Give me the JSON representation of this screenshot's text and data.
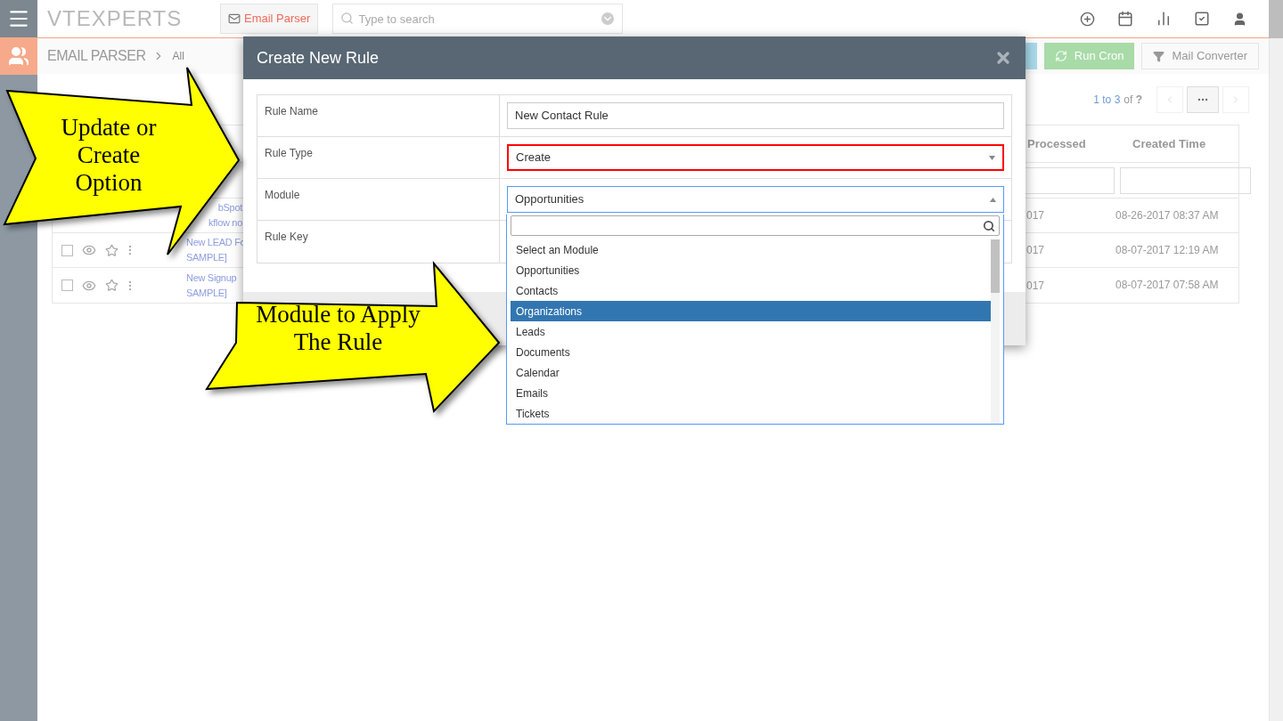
{
  "topbar": {
    "logo": "VTEXPERTS",
    "module_button": "Email Parser",
    "search": {
      "placeholder": "Type to search"
    }
  },
  "breadcrumb": {
    "module": "EMAIL PARSER",
    "view": "All"
  },
  "actions": [
    {
      "kind": "hidden"
    },
    {
      "kind": "cron",
      "label": "Run Cron"
    },
    {
      "kind": "converter",
      "label": "Mail Converter"
    }
  ],
  "pager": {
    "range": "1 to 3",
    "total": "of **?**"
  },
  "table": {
    "columns": [
      "Processed",
      "Created Time"
    ],
    "rows": [
      {
        "subject": [
          "bSpot",
          "kflow no"
        ],
        "processed": "017",
        "created": "08-26-2017 08:37 AM"
      },
      {
        "checked": false,
        "subject": [
          "New LEAD Fo",
          "SAMPLE]"
        ],
        "processed": "017",
        "created": "08-07-2017 12:19 AM"
      },
      {
        "checked": false,
        "subject": [
          "New Signup",
          "SAMPLE]"
        ],
        "processed": "017",
        "created": "08-07-2017 07:58 AM"
      }
    ]
  },
  "modal": {
    "title": "Create New Rule",
    "fields": [
      {
        "label": "Rule Name",
        "kind": "input",
        "value": "New Contact Rule"
      },
      {
        "label": "Rule Type",
        "kind": "select",
        "value": "Create",
        "highlighted": true
      },
      {
        "label": "Module",
        "kind": "select",
        "value": "Opportunities",
        "expanded": true
      },
      {
        "label": "Rule Key",
        "kind": "input"
      }
    ]
  },
  "dropdown": {
    "options": [
      {
        "label": "Select an Module",
        "selected": false
      },
      {
        "label": "Opportunities",
        "selected": false
      },
      {
        "label": "Contacts",
        "selected": false
      },
      {
        "label": "Organizations",
        "selected": true
      },
      {
        "label": "Leads",
        "selected": false
      },
      {
        "label": "Documents",
        "selected": false
      },
      {
        "label": "Calendar",
        "selected": false
      },
      {
        "label": "Emails",
        "selected": false
      },
      {
        "label": "Tickets",
        "selected": false
      }
    ]
  },
  "annotations": [
    {
      "text": "Update or Create Option"
    },
    {
      "text": "Module to Apply The Rule"
    }
  ]
}
